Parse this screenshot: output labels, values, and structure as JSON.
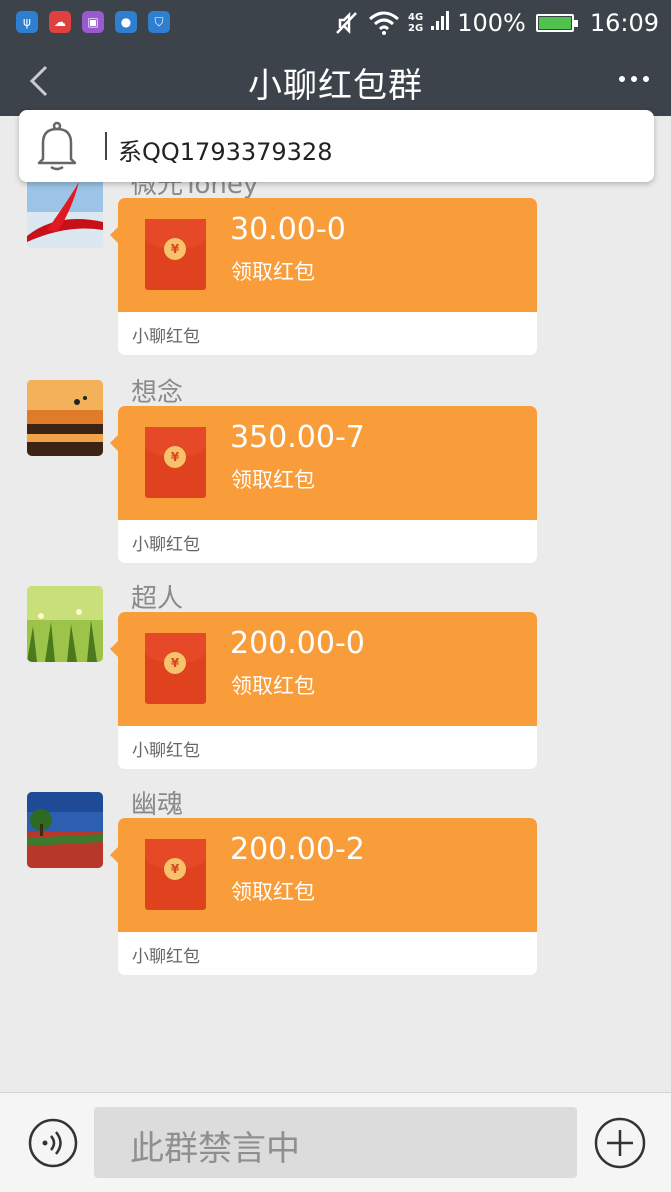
{
  "status_bar": {
    "app_icons": [
      {
        "name": "usb-icon",
        "color": "#2f7fd1",
        "glyph": "ψ"
      },
      {
        "name": "cloud-icon",
        "color": "#e04040",
        "glyph": "☁"
      },
      {
        "name": "gallery-icon",
        "color": "#9b59d0",
        "glyph": "▣"
      },
      {
        "name": "message-icon",
        "color": "#2f7fd1",
        "glyph": "●"
      },
      {
        "name": "shield-icon",
        "color": "#2f7fd1",
        "glyph": "⛉"
      }
    ],
    "network_top": "4G",
    "network_bottom": "2G",
    "battery": "100%",
    "time": "16:09"
  },
  "header": {
    "title": "小聊红包群"
  },
  "notice": {
    "text": "系QQ1793379328"
  },
  "messages": [
    {
      "sender": "微光Toney",
      "amount": "30.00-0",
      "claim": "领取红包",
      "label": "小聊红包"
    },
    {
      "sender": "想念",
      "amount": "350.00-7",
      "claim": "领取红包",
      "label": "小聊红包"
    },
    {
      "sender": "超人",
      "amount": "200.00-0",
      "claim": "领取红包",
      "label": "小聊红包"
    },
    {
      "sender": "幽魂",
      "amount": "200.00-2",
      "claim": "领取红包",
      "label": "小聊红包"
    }
  ],
  "input_bar": {
    "placeholder": "此群禁言中"
  },
  "colors": {
    "header_bg": "#3d434b",
    "card_orange": "#f99d3a",
    "envelope_red": "#e0411f"
  }
}
